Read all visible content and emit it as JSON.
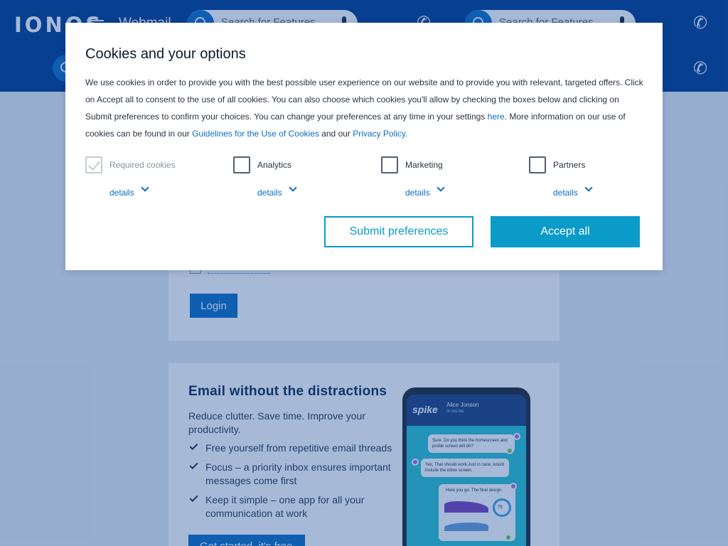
{
  "header": {
    "logo": "IONOS",
    "app_title": "Webmail",
    "search_placeholder_1": "Search for Features",
    "search_placeholder_2": "Search for Features",
    "phone_glyph": "✆"
  },
  "login": {
    "login_label": "Login"
  },
  "promo": {
    "title": "Email without the distractions",
    "lead": "Reduce clutter. Save time. Improve your productivity.",
    "bullets": [
      "Free yourself from repetitive email threads",
      "Focus – a priority inbox ensures important messages come first",
      "Keep it simple – one app for all your communication at work"
    ],
    "cta": "Get started, it's free",
    "mock": {
      "brand": "spike",
      "contact": "Alice Jonson",
      "status": "IS ONLINE",
      "msg1": "Sure. Do you think the homescreen and profile screen will do?",
      "msg2": "Yes, That should work.Just in case, would include the inbox screen.",
      "msg3": "Here you go. The final design.",
      "donut_value": "75"
    }
  },
  "cookie_modal": {
    "title": "Cookies and your options",
    "text_1": "We use cookies in order to provide you with the best possible user experience on our website and to provide you with relevant, targeted offers. Click on Accept all to consent to the use of all cookies. You can also choose which cookies you'll allow by checking the boxes below and clicking on Submit preferences to confirm your choices. You can change your preferences at any time in your settings ",
    "link_here": "here",
    "text_2": ". More information on our use of cookies can be found in our ",
    "link_guidelines": "Guidelines for the Use of Cookies",
    "text_3": " and our ",
    "link_privacy": "Privacy Policy",
    "text_4": ".",
    "options": [
      {
        "label": "Required cookies",
        "details": "details",
        "checked": true,
        "disabled": true
      },
      {
        "label": "Analytics",
        "details": "details",
        "checked": false,
        "disabled": false
      },
      {
        "label": "Marketing",
        "details": "details",
        "checked": false,
        "disabled": false
      },
      {
        "label": "Partners",
        "details": "details",
        "checked": false,
        "disabled": false
      }
    ],
    "submit_label": "Submit preferences",
    "accept_label": "Accept all"
  }
}
